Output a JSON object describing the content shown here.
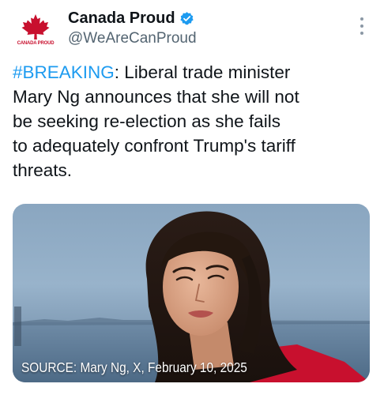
{
  "account": {
    "display_name": "Canada Proud",
    "handle": "@WeAreCanProud",
    "avatar_text": "CANADA PROUD",
    "verified": true
  },
  "tweet": {
    "hashtag": "#BREAKING",
    "lines": [
      ": Liberal trade minister",
      "Mary Ng announces that she will not",
      "be seeking re-election as she fails",
      "to adequately confront Trump's tariff",
      "threats."
    ]
  },
  "media": {
    "caption": "SOURCE: Mary Ng, X, February 10, 2025"
  },
  "colors": {
    "accent": "#1d9bf0",
    "verified": "#1d9bf0",
    "brand_red": "#c8102e",
    "handle_gray": "#536471"
  },
  "icons": {
    "avatar": "maple-leaf-icon",
    "verified": "verified-badge-icon",
    "more": "more-options-icon"
  }
}
